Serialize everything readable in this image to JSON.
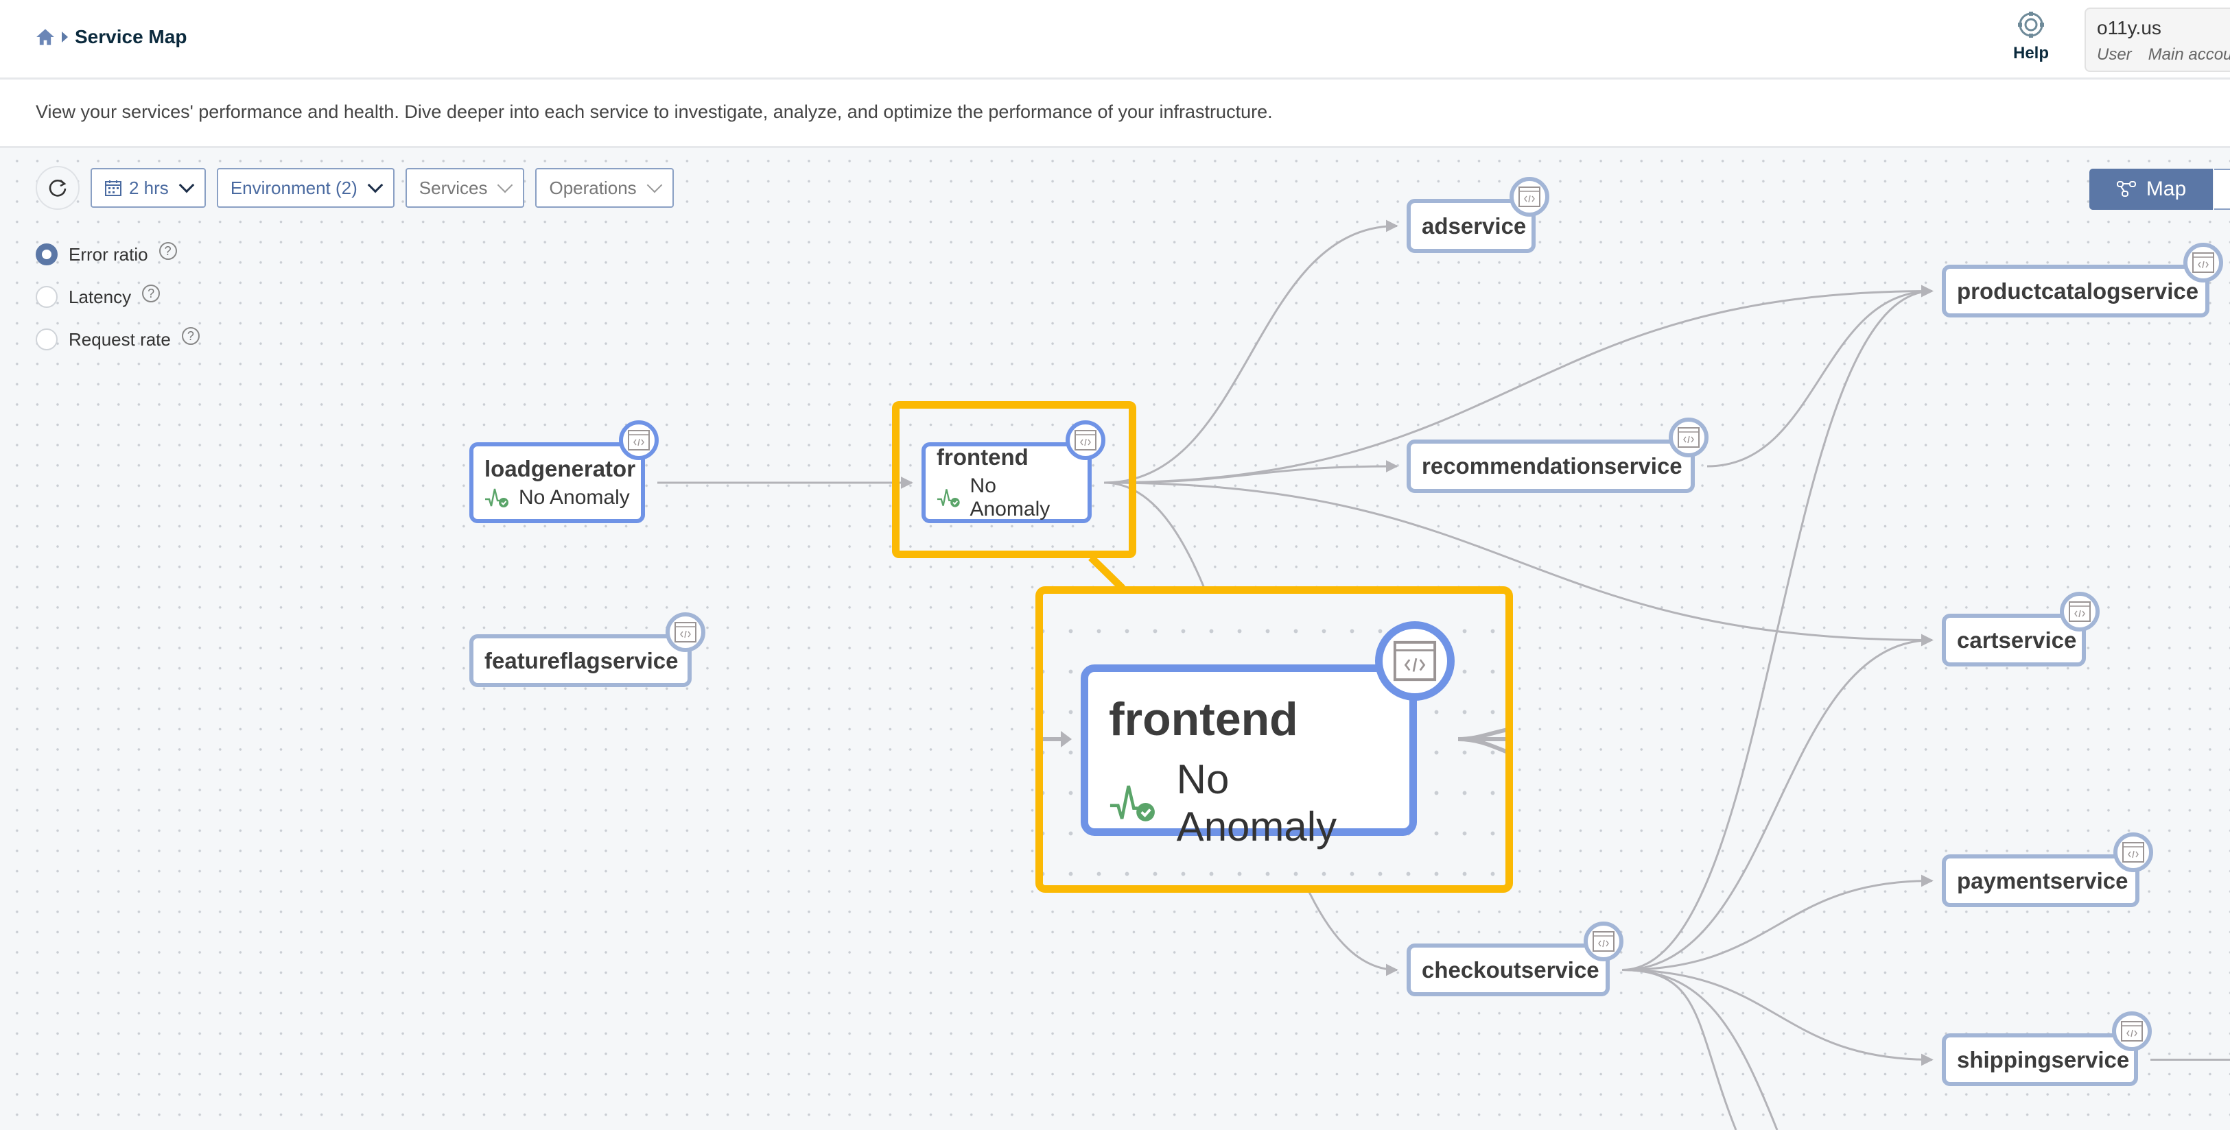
{
  "header": {
    "breadcrumb_home_icon": "home-icon",
    "title": "Service Map",
    "help_label": "Help",
    "help_icon": "lifebuoy-icon",
    "account": {
      "org": "o11y.us",
      "role": "User",
      "account_type": "Main account"
    }
  },
  "description": "View your services' performance and health. Dive deeper into each service to investigate, analyze, and optimize the performance of your infrastructure.",
  "toolbar": {
    "refresh_icon": "refresh-icon",
    "time_range": "2 hrs",
    "environment": "Environment (2)",
    "services": "Services",
    "operations": "Operations"
  },
  "metrics": {
    "selected": "Error ratio",
    "options": [
      {
        "label": "Error ratio",
        "checked": true
      },
      {
        "label": "Latency",
        "checked": false
      },
      {
        "label": "Request rate",
        "checked": false
      }
    ]
  },
  "view_toggle": {
    "map_label": "Map",
    "map_icon": "topology-icon",
    "active": "Map"
  },
  "colors": {
    "accent": "#5b77a6",
    "highlight": "#fbb904",
    "node_primary_border": "#6f93e6",
    "node_border": "#a2b5d6",
    "healthy": "#5aa469",
    "edge": "#b3b3b8"
  },
  "nodes": [
    {
      "id": "loadgenerator",
      "name": "loadgenerator",
      "status": "No Anomaly",
      "primary": true
    },
    {
      "id": "frontend",
      "name": "frontend",
      "status": "No Anomaly",
      "primary": true
    },
    {
      "id": "featureflagservice",
      "name": "featureflagservice"
    },
    {
      "id": "adservice",
      "name": "adservice"
    },
    {
      "id": "recommendationservice",
      "name": "recommendationservice"
    },
    {
      "id": "productcatalogservice",
      "name": "productcatalogservice"
    },
    {
      "id": "cartservice",
      "name": "cartservice"
    },
    {
      "id": "checkoutservice",
      "name": "checkoutservice"
    },
    {
      "id": "paymentservice",
      "name": "paymentservice"
    },
    {
      "id": "shippingservice",
      "name": "shippingservice"
    }
  ],
  "edges": [
    [
      "loadgenerator",
      "frontend"
    ],
    [
      "frontend",
      "adservice"
    ],
    [
      "frontend",
      "recommendationservice"
    ],
    [
      "frontend",
      "productcatalogservice"
    ],
    [
      "frontend",
      "cartservice"
    ],
    [
      "frontend",
      "checkoutservice"
    ],
    [
      "recommendationservice",
      "productcatalogservice"
    ],
    [
      "checkoutservice",
      "productcatalogservice"
    ],
    [
      "checkoutservice",
      "cartservice"
    ],
    [
      "checkoutservice",
      "paymentservice"
    ],
    [
      "checkoutservice",
      "shippingservice"
    ]
  ],
  "callout": {
    "name": "frontend",
    "status": "No Anomaly"
  }
}
